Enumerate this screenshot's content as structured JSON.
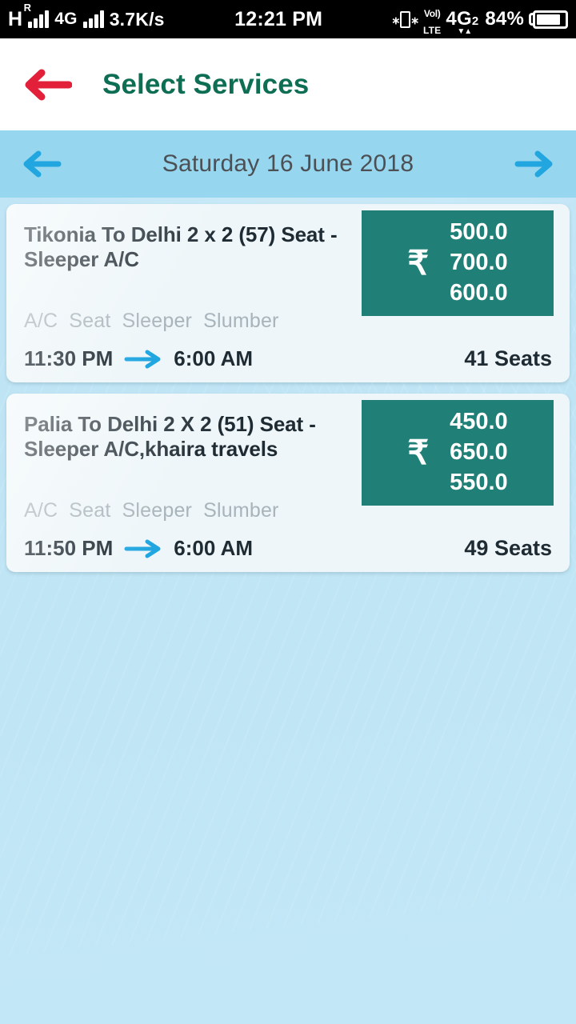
{
  "statusbar": {
    "network_letter": "H",
    "roaming_badge": "R",
    "network_label_2": "4G",
    "data_speed": "3.7K/s",
    "clock": "12:21 PM",
    "volte_top": "Vol)",
    "volte_bottom": "LTE",
    "sim_signal": "4G",
    "sim_signal_sub": "2",
    "battery_percent": "84%",
    "icons": [
      "roaming-signal-icon",
      "signal-bars-icon",
      "vibrate-icon",
      "volte-icon",
      "battery-icon"
    ]
  },
  "appbar": {
    "back_icon": "back-arrow-icon",
    "title": "Select Services",
    "title_color": "#0d6e53",
    "back_arrow_color": "#e3203a"
  },
  "datebar": {
    "prev_icon": "arrow-left-icon",
    "next_icon": "arrow-right-icon",
    "date": "Saturday 16 June 2018",
    "background_color": "#97d6ef",
    "arrow_color": "#21a6e0"
  },
  "services": [
    {
      "title": "Tikonia To Delhi 2 x 2 (57) Seat - Sleeper A/C",
      "currency_symbol": "₹",
      "prices": [
        "500.0",
        "700.0",
        "600.0"
      ],
      "amenities": [
        "A/C",
        "Seat",
        "Sleeper",
        "Slumber"
      ],
      "departure_time": "11:30 PM",
      "arrival_time": "6:00 AM",
      "seats_available": "41 Seats",
      "price_box_color": "#208077"
    },
    {
      "title": "Palia To Delhi 2 X 2 (51) Seat - Sleeper A/C,khaira travels",
      "currency_symbol": "₹",
      "prices": [
        "450.0",
        "650.0",
        "550.0"
      ],
      "amenities": [
        "A/C",
        "Seat",
        "Sleeper",
        "Slumber"
      ],
      "departure_time": "11:50 PM",
      "arrival_time": "6:00 AM",
      "seats_available": "49 Seats",
      "price_box_color": "#208077"
    }
  ],
  "theme": {
    "page_background": "#bfe4f4",
    "card_background": "#eef6f9",
    "text_primary": "#1f2b33",
    "text_muted": "#a8b4bb",
    "accent_teal": "#208077",
    "accent_blue": "#21a6e0"
  }
}
